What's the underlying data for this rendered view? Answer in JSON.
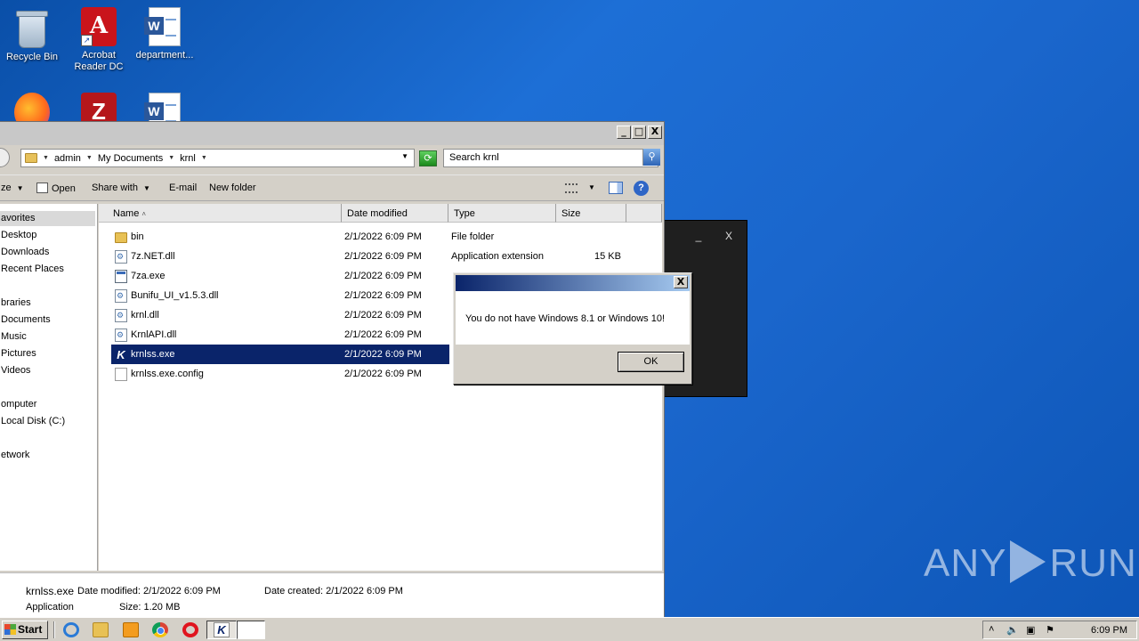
{
  "desktop": {
    "icons": [
      {
        "label": "Recycle Bin",
        "icon": "recycle-bin-icon"
      },
      {
        "label": "Acrobat Reader DC",
        "icon": "acrobat-icon"
      },
      {
        "label": "department...",
        "icon": "word-document-icon"
      },
      {
        "label": "",
        "icon": "firefox-icon"
      },
      {
        "label": "",
        "icon": "filezilla-icon"
      },
      {
        "label": "",
        "icon": "word-document-icon"
      }
    ]
  },
  "console": {
    "minimize": "_",
    "close": "X"
  },
  "explorer": {
    "title_buttons": {
      "minimize": "_",
      "maximize": "□",
      "close": "X"
    },
    "breadcrumb": [
      "admin",
      "My Documents",
      "krnl"
    ],
    "search_placeholder": "Search krnl",
    "toolbar": {
      "organize_partial": "ze",
      "open": "Open",
      "share_with": "Share with",
      "email": "E-mail",
      "new_folder": "New folder",
      "help": "?"
    },
    "nav": {
      "favorites": "avorites",
      "desktop": "Desktop",
      "downloads": "Downloads",
      "recent_places": "Recent Places",
      "libraries": "braries",
      "documents": "Documents",
      "music": "Music",
      "pictures": "Pictures",
      "videos": "Videos",
      "computer": "omputer",
      "local_disk": "Local Disk (C:)",
      "network": "etwork"
    },
    "columns": {
      "name": "Name",
      "sort_arrow": "˄",
      "date": "Date modified",
      "type": "Type",
      "size": "Size"
    },
    "files": [
      {
        "name": "bin",
        "date": "2/1/2022 6:09 PM",
        "type": "File folder",
        "size": ""
      },
      {
        "name": "7z.NET.dll",
        "date": "2/1/2022 6:09 PM",
        "type": "Application extension",
        "size": "15 KB"
      },
      {
        "name": "7za.exe",
        "date": "2/1/2022 6:09 PM",
        "type": "",
        "size": ""
      },
      {
        "name": "Bunifu_UI_v1.5.3.dll",
        "date": "2/1/2022 6:09 PM",
        "type": "",
        "size": ""
      },
      {
        "name": "krnl.dll",
        "date": "2/1/2022 6:09 PM",
        "type": "",
        "size": ""
      },
      {
        "name": "KrnlAPI.dll",
        "date": "2/1/2022 6:09 PM",
        "type": "",
        "size": ""
      },
      {
        "name": "krnlss.exe",
        "date": "2/1/2022 6:09 PM",
        "type": "",
        "size": ""
      },
      {
        "name": "krnlss.exe.config",
        "date": "2/1/2022 6:09 PM",
        "type": "",
        "size": ""
      }
    ],
    "details": {
      "filename": "krnlss.exe",
      "date_modified": "Date modified: 2/1/2022 6:09 PM",
      "date_created": "Date created: 2/1/2022 6:09 PM",
      "kind": "Application",
      "size": "Size: 1.20 MB"
    }
  },
  "message_box": {
    "close": "X",
    "text": "You do not have Windows 8.1 or Windows 10!",
    "ok": "OK"
  },
  "watermark": {
    "left": "ANY",
    "right": "RUN"
  },
  "taskbar": {
    "start": "Start",
    "tray_up": "˄",
    "time": "6:09 PM"
  }
}
